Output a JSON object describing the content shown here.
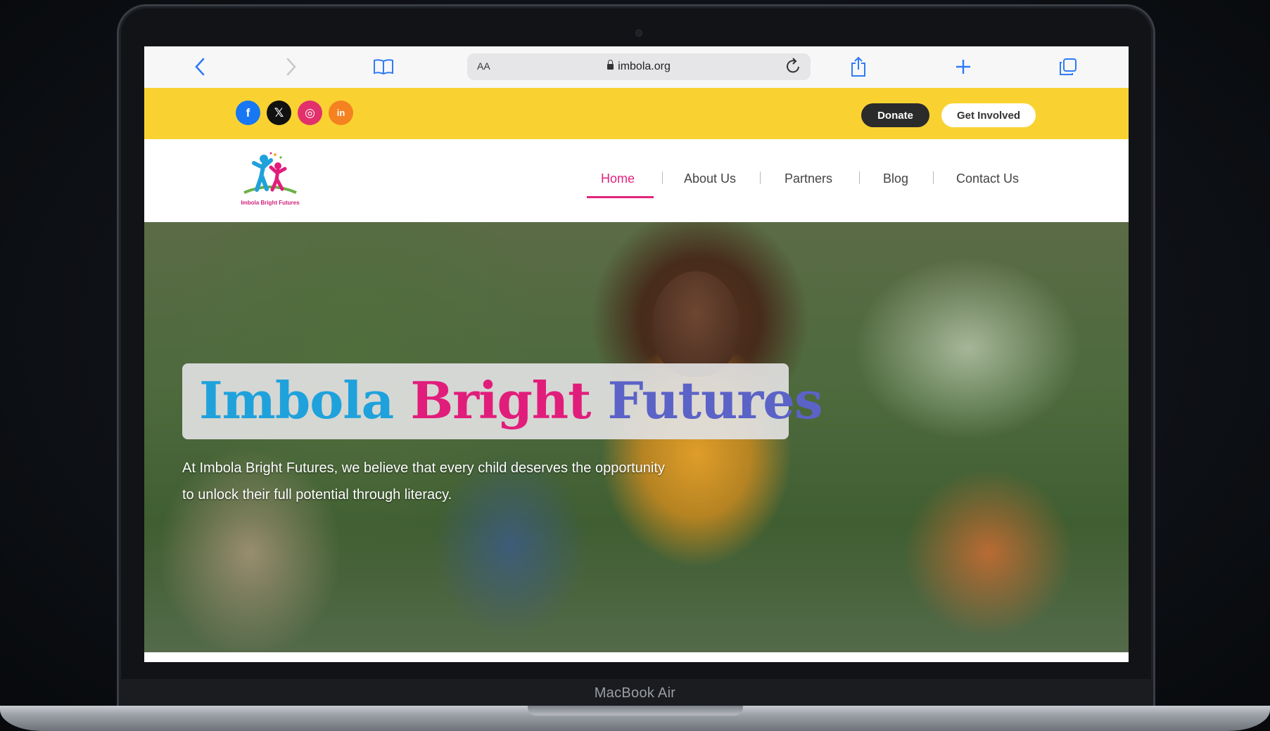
{
  "device": {
    "label": "MacBook Air"
  },
  "browser": {
    "aa_label": "AA",
    "url": "imbola.org",
    "back_icon": "chevron-left-icon",
    "forward_icon": "chevron-right-icon",
    "bookmarks_icon": "book-icon",
    "reload_icon": "reload-icon",
    "share_icon": "share-icon",
    "new_tab_icon": "plus-icon",
    "tabs_icon": "tabs-icon"
  },
  "topbar": {
    "socials": [
      {
        "name": "facebook-icon",
        "glyph": "f",
        "color": "#1877f2"
      },
      {
        "name": "x-icon",
        "glyph": "𝕏",
        "color": "#111111"
      },
      {
        "name": "instagram-icon",
        "glyph": "◎",
        "color": "#e1306c"
      },
      {
        "name": "linkedin-icon",
        "glyph": "in",
        "color": "#f58220"
      }
    ],
    "donate_label": "Donate",
    "get_involved_label": "Get Involved"
  },
  "header": {
    "logo_text": "Imbola Bright Futures",
    "nav": [
      {
        "label": "Home",
        "active": true
      },
      {
        "label": "About Us"
      },
      {
        "label": "Partners"
      },
      {
        "label": "Blog"
      },
      {
        "label": "Contact Us"
      }
    ]
  },
  "hero": {
    "title_part1": "Imbola",
    "title_part2": "Bright",
    "title_part3": "Futures",
    "tagline": "At Imbola Bright Futures, we believe that every child deserves the opportunity to unlock their full potential through literacy."
  },
  "colors": {
    "topbar_yellow": "#f9d232",
    "brand_pink": "#e2237c",
    "brand_blue": "#1fa2dc",
    "safari_blue": "#2f7bf5"
  }
}
